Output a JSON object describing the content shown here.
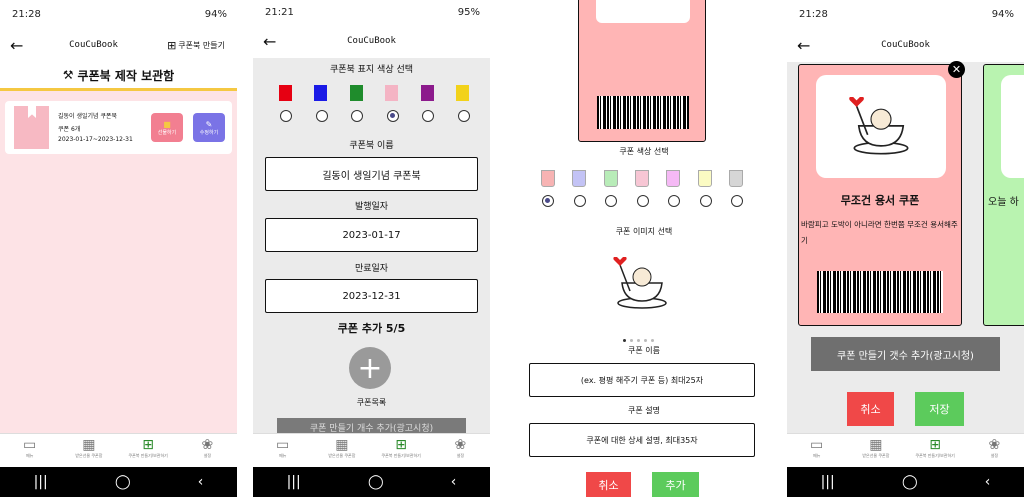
{
  "screen1": {
    "time": "21:28",
    "battery": "94%",
    "title": "CouCuBook",
    "make_button": "쿠폰북 만들기",
    "banner": "쿠폰북 제작 보관함",
    "book": {
      "name": "길동이 생일기념 쿠폰북",
      "count": "쿠폰 6개",
      "dates": "2023-01-17~2023-12-31",
      "gift_label": "선물하기",
      "edit_label": "수정하기"
    }
  },
  "screen2": {
    "time": "21:21",
    "battery": "95%",
    "title": "CouCuBook",
    "color_title": "쿠폰북 표지 색상 선택",
    "name_label": "쿠폰북 이름",
    "name_value": "길동이 생일기념 쿠폰북",
    "issue_label": "발행일자",
    "issue_value": "2023-01-17",
    "expire_label": "만료일자",
    "expire_value": "2023-12-31",
    "add_label": "쿠폰 추가 5/5",
    "list_label": "쿠폰목록",
    "hidden_button": "쿠폰 만들기 개수 추가(광고시청)"
  },
  "screen3": {
    "color_title": "쿠폰 색상 선택",
    "image_title": "쿠폰 이미지 선택",
    "name_label": "쿠폰 이름",
    "name_placeholder": "(ex. 평평 해주기 쿠폰 등) 최대25자",
    "desc_label": "쿠폰 설명",
    "desc_placeholder": "쿠폰에 대한 상세 설명, 최대35자",
    "cancel": "취소",
    "add": "추가"
  },
  "screen4": {
    "time": "21:28",
    "battery": "94%",
    "title": "CouCuBook",
    "coupon_title": "무조건 용서 쿠폰",
    "coupon_desc": "바람피고 도박이 아니라면 한번쯤 무조건 용서해주기",
    "next_coupon_title": "오늘 하",
    "ad_button": "쿠폰 만들기 갯수 추가(광고시청)",
    "cancel": "취소",
    "save": "저장"
  },
  "nav": [
    {
      "label": "메뉴",
      "icon": "shop-icon"
    },
    {
      "label": "받은선물 쿠폰함",
      "icon": "gift-icon"
    },
    {
      "label": "쿠폰북 만들기/보관하기",
      "icon": "add-box-icon"
    },
    {
      "label": "설정",
      "icon": "flower-icon"
    }
  ],
  "colors": {
    "book_palette": [
      "#e60012",
      "#1a1ae6",
      "#1f8c2c",
      "#f4b4c4",
      "#8c1a8c",
      "#f2d21a"
    ],
    "coupon_palette": [
      "#f7b3b3",
      "#c3c3f5",
      "#b8ecb8",
      "#f7c6d4",
      "#f5b9f5",
      "#fbfbc3",
      "#d6d6d6"
    ],
    "pink": "#ffb5b5",
    "green": "#b9f3b0",
    "red_btn": "#f04848",
    "green_btn": "#5ccb5c",
    "gray_btn": "#6f6f6f"
  }
}
